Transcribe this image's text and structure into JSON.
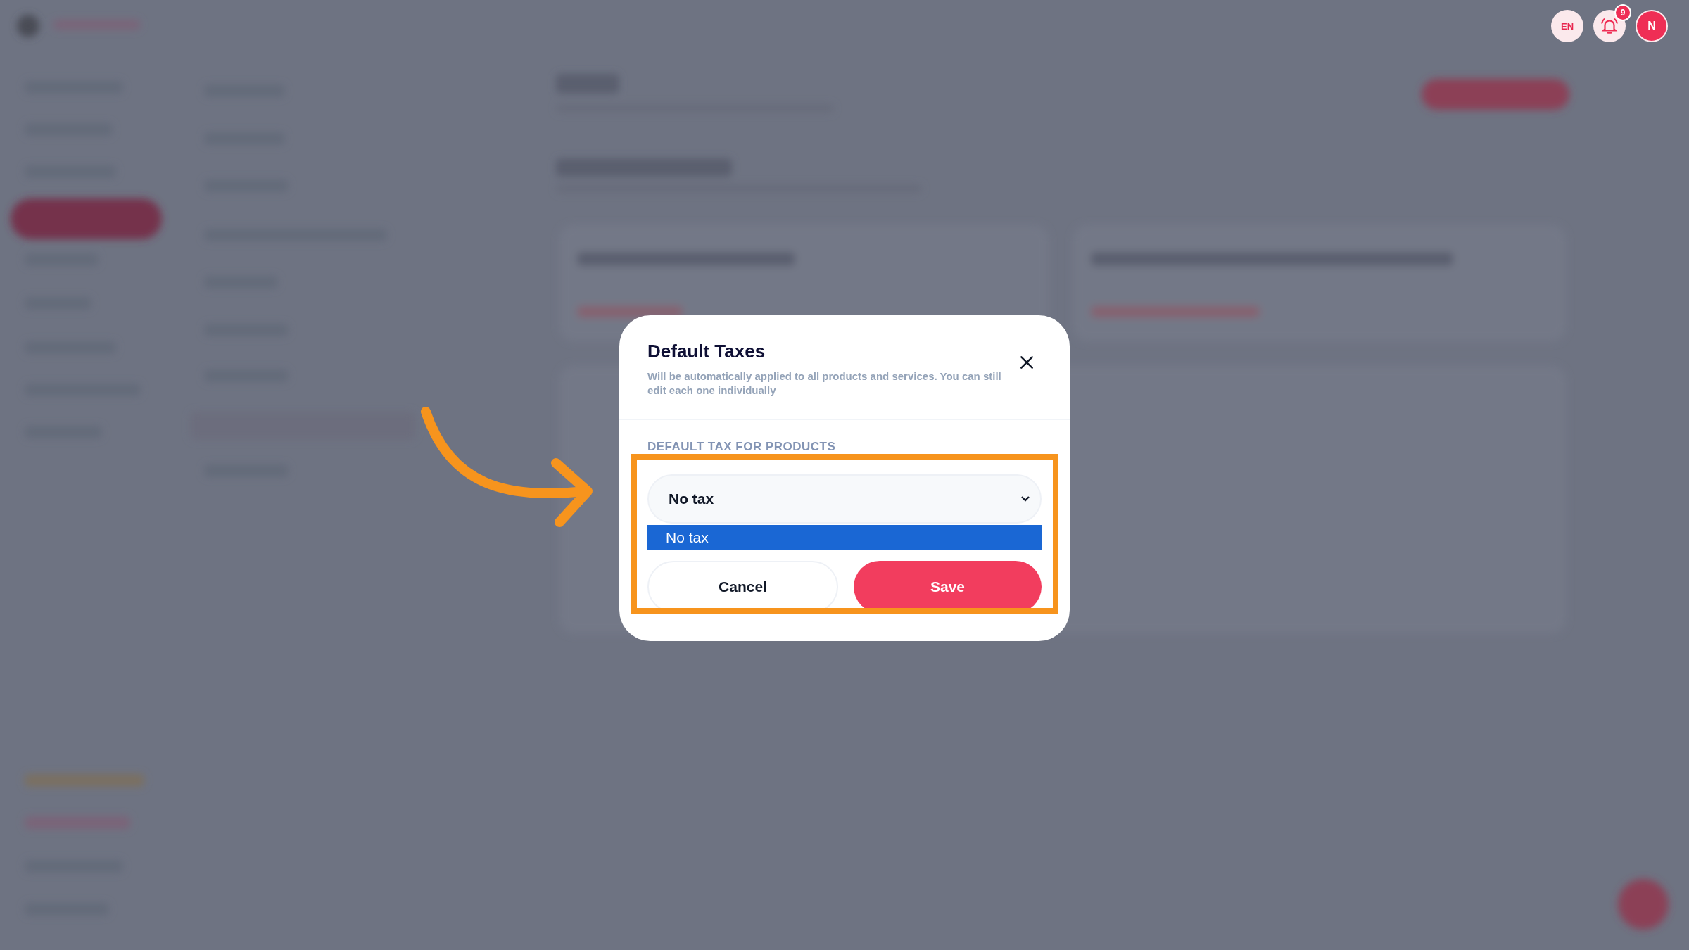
{
  "header": {
    "language": "EN",
    "notifications": {
      "count": "9"
    },
    "avatar_initial": "N"
  },
  "dialog": {
    "title": "Default Taxes",
    "subtitle": "Will be automatically applied to all products and services. You can still edit each one individually",
    "field_label": "DEFAULT TAX FOR PRODUCTS",
    "select": {
      "value": "No tax",
      "options": [
        {
          "label": "No tax",
          "selected": true
        }
      ]
    },
    "buttons": [
      {
        "label": "Cancel",
        "kind": "secondary"
      },
      {
        "label": "Save",
        "kind": "primary"
      }
    ]
  }
}
